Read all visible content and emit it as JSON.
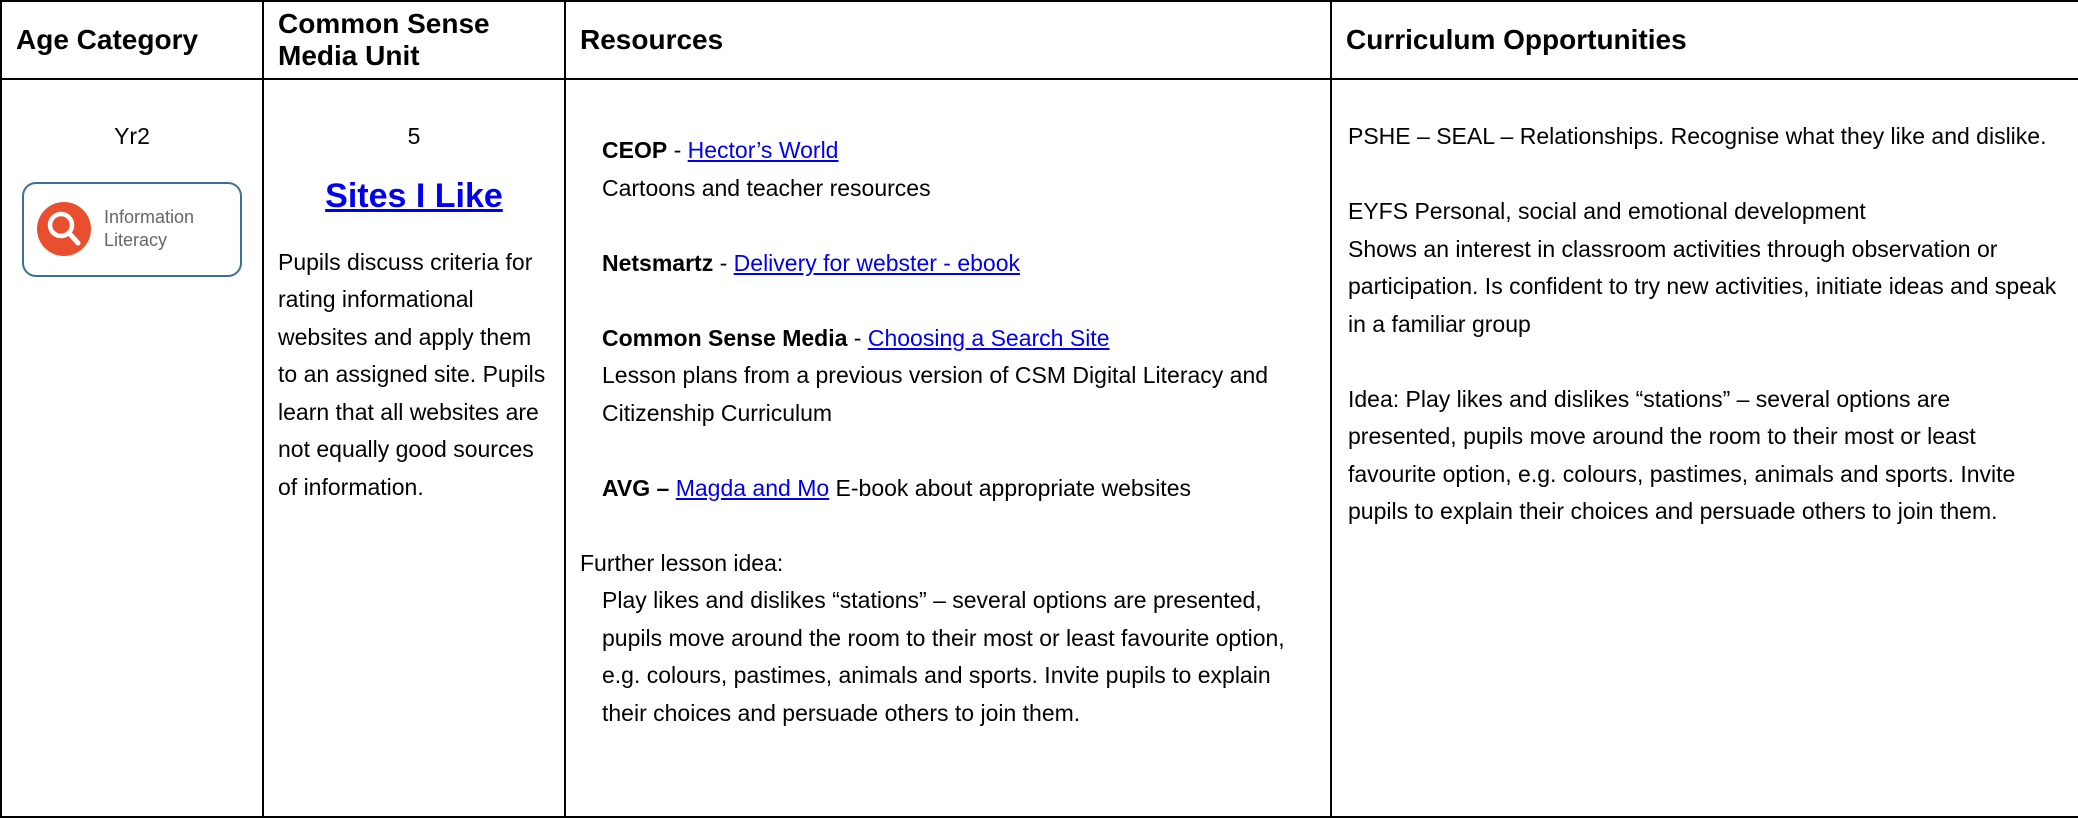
{
  "headers": {
    "age": "Age Category",
    "unit": "Common Sense Media Unit",
    "resources": "Resources",
    "curriculum": "Curriculum Opportunities"
  },
  "row": {
    "age": "Yr2",
    "badge": {
      "icon": "magnifier-icon",
      "line1": "Information",
      "line2": "Literacy",
      "accent": "#e94f2f",
      "border": "#3f7090"
    },
    "unit_number": "5",
    "unit_title": "Sites I Like",
    "unit_description": "Pupils discuss criteria for rating informational websites and apply them to an assigned site. Pupils learn that all websites are not equally good sources of information.",
    "resources": [
      {
        "source": "CEOP",
        "sep": " - ",
        "link": "Hector’s World",
        "after": "",
        "note": "Cartoons and teacher resources"
      },
      {
        "source": "Netsmartz",
        "sep": " - ",
        "link": "Delivery for webster - ebook",
        "after": "",
        "note": ""
      },
      {
        "source": "Common Sense Media",
        "sep": " - ",
        "link": "Choosing a Search Site",
        "after": "",
        "note": "Lesson plans from a previous version of CSM Digital Literacy and Citizenship Curriculum"
      },
      {
        "source": "AVG –",
        "sep": " ",
        "link": "Magda and Mo",
        "after": " E-book about appropriate websites",
        "note": ""
      }
    ],
    "further_label": "Further lesson idea:",
    "further_text": "Play likes and dislikes “stations” – several options are presented, pupils move around the room to their most or least favourite option, e.g. colours, pastimes, animals and sports.  Invite pupils to explain their choices and persuade others to join them.",
    "curriculum": [
      "PSHE – SEAL – Relationships. Recognise what they like and dislike.",
      "EYFS Personal, social and emotional development\nShows an interest in classroom activities through observation or participation.  Is confident to try new activities, initiate ideas and speak in a familiar group",
      "Idea: Play likes and dislikes “stations” – several options are presented, pupils move around the room to their most or least favourite option, e.g. colours, pastimes, animals and sports.  Invite pupils to explain their choices and persuade others to join them."
    ]
  }
}
